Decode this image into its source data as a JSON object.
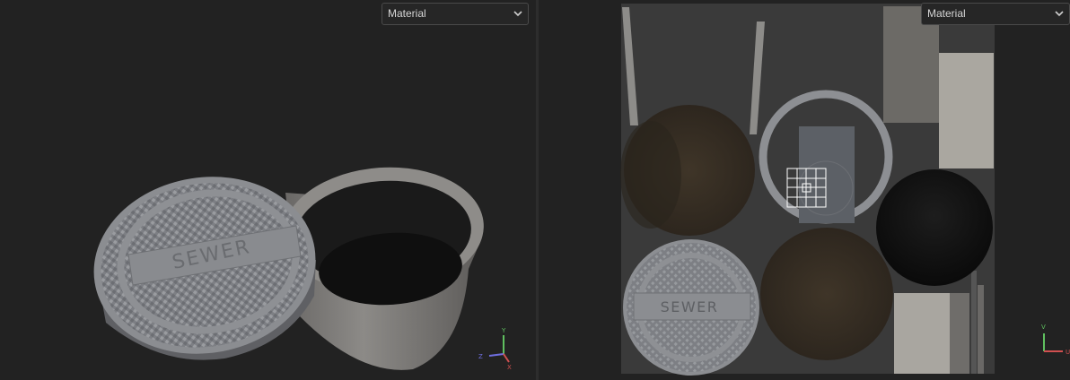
{
  "left_viewport": {
    "channel_select": {
      "value": "Material"
    },
    "model_lid_text": "SEWER",
    "axis_gizmo": {
      "y": "Y",
      "z": "Z",
      "x": "X"
    }
  },
  "right_viewport": {
    "channel_select": {
      "value": "Material"
    },
    "uv_lid_text": "SEWER",
    "axis_gizmo": {
      "v": "V",
      "u": "U"
    }
  },
  "colors": {
    "background": "#222222",
    "uv_canvas": "#3a3a3a",
    "metal": "#8a8c90",
    "dirt": "#3b3328",
    "dark": "#141414"
  },
  "icons": [
    "chevron-down-icon",
    "axis-gizmo-icon",
    "uv-gizmo-icon",
    "pivot-grid-icon"
  ]
}
